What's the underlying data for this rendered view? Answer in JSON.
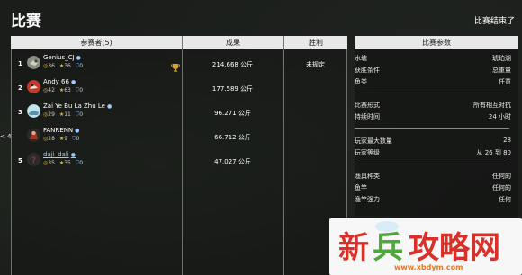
{
  "page": {
    "title": "比赛",
    "status": "比赛结束了"
  },
  "table": {
    "headers": {
      "participants": "参赛者(5)",
      "result": "成果",
      "win": "胜利"
    },
    "rows": [
      {
        "rank": "1",
        "name": "Genius_CJ",
        "dot": "●",
        "stat1": "36",
        "stat2": "36",
        "stat3": "0",
        "result": "214.668 公斤",
        "win": "未规定",
        "trophy": true
      },
      {
        "rank": "2",
        "name": "Andy 66",
        "dot": "●",
        "stat1": "42",
        "stat2": "63",
        "stat3": "0",
        "result": "177.589 公斤",
        "win": ""
      },
      {
        "rank": "3",
        "name": "Zai Ye Bu La Zhu Le",
        "dot": "●",
        "stat1": "29",
        "stat2": "11",
        "stat3": "0",
        "result": "96.271 公斤",
        "win": ""
      },
      {
        "rank": "4",
        "name": "FANRENN",
        "dot": "●",
        "stat1": "28",
        "stat2": "9",
        "stat3": "0",
        "result": "66.712 公斤",
        "win": "",
        "marker": "< 4"
      },
      {
        "rank": "5",
        "name": "daji_dali",
        "dot": "●",
        "stat1": "35",
        "stat2": "35",
        "stat3": "0",
        "result": "47.027 公斤",
        "win": "",
        "link": true
      }
    ]
  },
  "params": {
    "header": "比赛参数",
    "groups": [
      [
        {
          "label": "水塘",
          "value": "琥珀湖"
        },
        {
          "label": "获胜条件",
          "value": "总重量"
        },
        {
          "label": "鱼类",
          "value": "任意"
        }
      ],
      [
        {
          "label": "比赛形式",
          "value": "所有相互对抗"
        },
        {
          "label": "持续时间",
          "value": "24 小时"
        }
      ],
      [
        {
          "label": "玩家最大数量",
          "value": "28"
        },
        {
          "label": "玩家等级",
          "value": "从 26 到 80"
        }
      ],
      [
        {
          "label": "渔具种类",
          "value": "任何的"
        },
        {
          "label": "鱼竿",
          "value": "任何的"
        },
        {
          "label": "渔竿强力",
          "value": "任何"
        }
      ]
    ]
  },
  "watermark": {
    "logo": "新兵攻略网",
    "sub": "www.xbdym.com"
  },
  "colors": {
    "header_bg": "#e8e8e8",
    "gold": "#e0b94a",
    "blue": "#5aa0e6",
    "brand_green": "#4fa83a",
    "brand_red": "#d9302a",
    "brand_orange": "#e8771f"
  },
  "icons": {
    "trophy": "trophy-icon",
    "fish": "fish-icon",
    "star": "star-icon",
    "shield": "shield-icon"
  }
}
